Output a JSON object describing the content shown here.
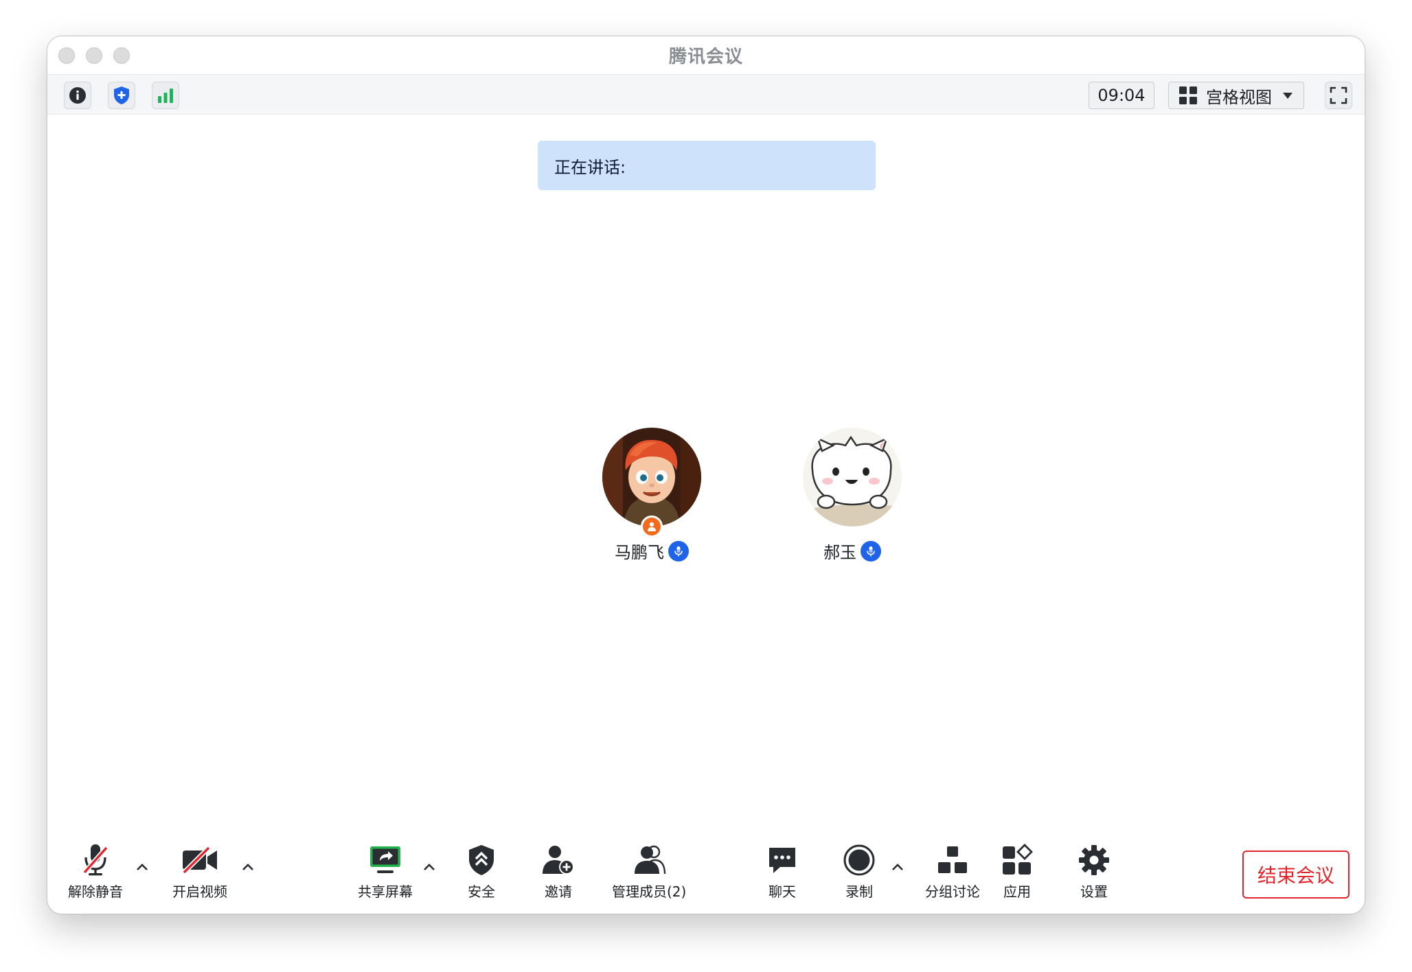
{
  "window": {
    "title": "腾讯会议"
  },
  "toolbar": {
    "timer": "09:04",
    "view_label": "宫格视图",
    "icons": [
      "info-icon",
      "shield-icon",
      "signal-icon",
      "grid-view-icon",
      "fullscreen-icon"
    ]
  },
  "speaking": {
    "label": "正在讲话:"
  },
  "participants": [
    {
      "name": "马鹏飞",
      "role": "host",
      "mic": "speaking"
    },
    {
      "name": "郝玉",
      "role": "member",
      "mic": "speaking"
    }
  ],
  "controls": {
    "unmute": "解除静音",
    "start_video": "开启视频",
    "share_screen": "共享屏幕",
    "security": "安全",
    "invite": "邀请",
    "manage_members": "管理成员(2)",
    "chat": "聊天",
    "record": "录制",
    "breakout": "分组讨论",
    "apps": "应用",
    "settings": "设置",
    "end_meeting": "结束会议"
  },
  "colors": {
    "accent": "#1f63e8",
    "danger": "#e3242b",
    "share_green": "#22b14c",
    "speaking_bg": "#cfe2fb",
    "host_badge": "#f26b1d"
  }
}
